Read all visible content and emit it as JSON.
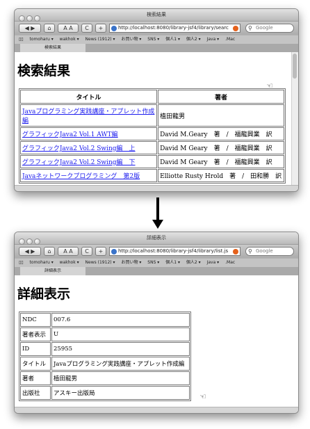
{
  "nav": {
    "back": "◀ ▶",
    "home": "⌂",
    "text_size": "A A",
    "reload": "C",
    "add": "+"
  },
  "bookmarks_icon": "book-icon",
  "bookmarks": [
    "tomoharu ▾",
    "wakhok ▾",
    "News (1912) ▾",
    "お買い物 ▾",
    "SNS ▾",
    "個人1 ▾",
    "個人2 ▾",
    "Java ▾",
    ".Mac"
  ],
  "search_placeholder": "Google",
  "window1": {
    "title": "検索結果",
    "url": "http://localhost:8080/library-jsf4/library/searc",
    "tab": "検索結果",
    "heading": "検索結果",
    "columns": [
      "タイトル",
      "著者"
    ],
    "rows": [
      {
        "title": "Javaプログラミング実践講座・アプレット作成編",
        "author": "植田龍男"
      },
      {
        "title": "グラフィックJava2 Vol.1 AWT編",
        "author": "David M.Geary　著　/　福龍興業　訳"
      },
      {
        "title": "グラフィックJava2 Vol.2 Swing編　上",
        "author": "David M Geary　著　/　福龍興業　訳"
      },
      {
        "title": "グラフィックJava2 Vol.2 Swing編　下",
        "author": "David M Geary　著　/　福龍興業　訳"
      },
      {
        "title": "Javaネットワークプログラミング　第2版",
        "author": "Elliotte Rusty Hrold　著　/　田和勝　訳"
      }
    ]
  },
  "window2": {
    "title": "詳細表示",
    "url": "http://localhost:8080/library-jsf4/library/list.js",
    "tab": "詳細表示",
    "heading": "詳細表示",
    "details": [
      {
        "label": "NDC",
        "value": "007.6"
      },
      {
        "label": "著者表示",
        "value": "U"
      },
      {
        "label": "ID",
        "value": "25955"
      },
      {
        "label": "タイトル",
        "value": "Javaプログラミング実践講座・アプレット作成編"
      },
      {
        "label": "著者",
        "value": "植田龍男"
      },
      {
        "label": "出版社",
        "value": "アスキー出版局"
      }
    ]
  }
}
